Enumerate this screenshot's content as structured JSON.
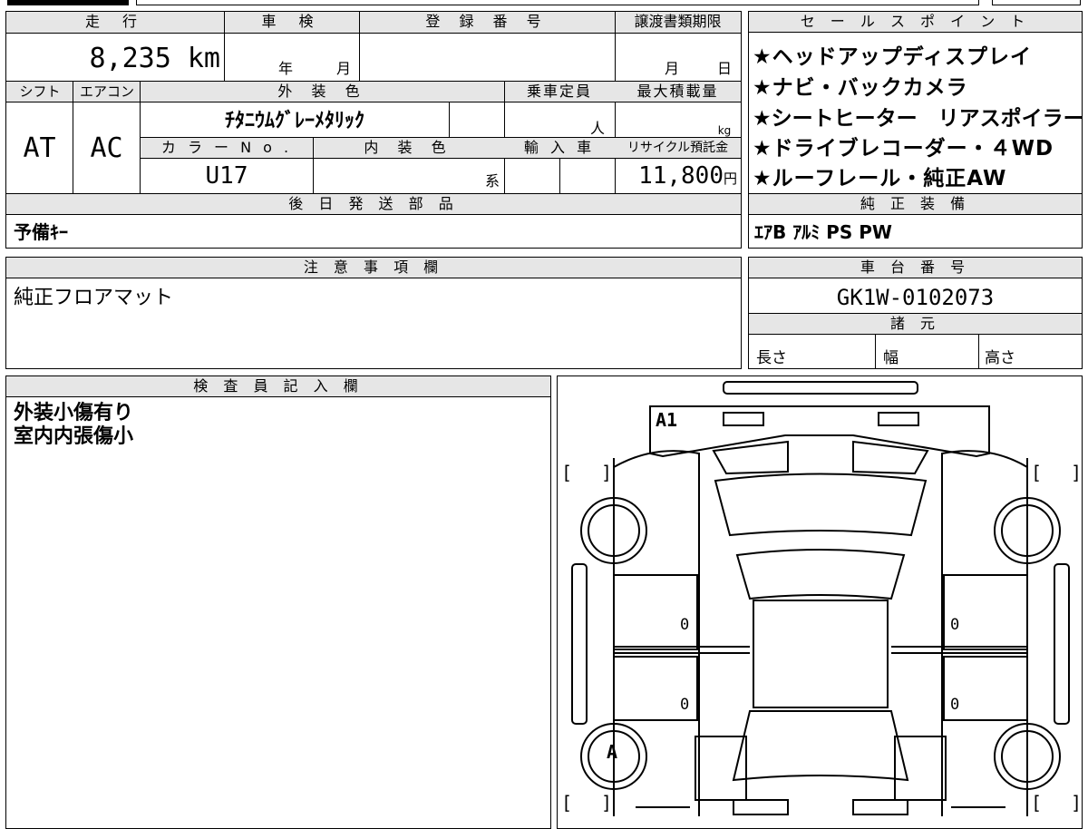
{
  "record": {
    "headers": {
      "mileage": "走 行",
      "inspection": "車 検",
      "registration": "登 録 番 号",
      "transfer": "譲渡書類期限",
      "shift": "シフト",
      "aircon": "エアコン",
      "exterior_color": "外 装 色",
      "capacity": "乗車定員",
      "max_load": "最大積載量",
      "color_no": "カ ラ ー N o .",
      "interior_color": "内 装 色",
      "import": "輸 入 車",
      "recycle": "リサイクル預託金"
    },
    "mileage": "8,235 km",
    "inspection_year_unit": "年",
    "inspection_month_unit": "月",
    "transfer_month_unit": "月",
    "transfer_day_unit": "日",
    "shift": "AT",
    "aircon": "AC",
    "exterior_color": "ﾁﾀﾆｳﾑｸﾞﾚｰﾒﾀﾘｯｸ",
    "capacity_unit": "人",
    "max_load_unit": "kg",
    "color_no": "U17",
    "interior_color_unit": "系",
    "recycle_fee": "11,800",
    "recycle_unit": "円"
  },
  "later_shipping": {
    "header": "後 日 発 送 部 品",
    "content": "予備ｷｰ"
  },
  "notes": {
    "header": "注 意 事 項 欄",
    "content": "純正フロアマット"
  },
  "inspector": {
    "header": "検 査 員 記 入 欄",
    "lines": [
      "外装小傷有り",
      "室内内張傷小"
    ]
  },
  "sales_points": {
    "header": "セ ー ル ス ポ イ ン ト",
    "items": [
      "★ヘッドアップディスプレイ",
      "★ナビ・バックカメラ",
      "★シートヒーター　リアスポイラー",
      "★ドライブレコーダー・４WD",
      "★ルーフレール・純正AW"
    ]
  },
  "equipment": {
    "header": "純 正 装 備",
    "content": "ｴｱB ｱﾙﾐ PS PW"
  },
  "chassis": {
    "header": "車 台 番 号",
    "number": "GK1W-0102073"
  },
  "specs": {
    "header": "諸 元",
    "length": "長さ",
    "width": "幅",
    "height": "高さ"
  },
  "diagram": {
    "marks": {
      "a1": "A1",
      "a": "A",
      "zero": "0"
    },
    "bracket_left": "[",
    "bracket_right": "]"
  }
}
